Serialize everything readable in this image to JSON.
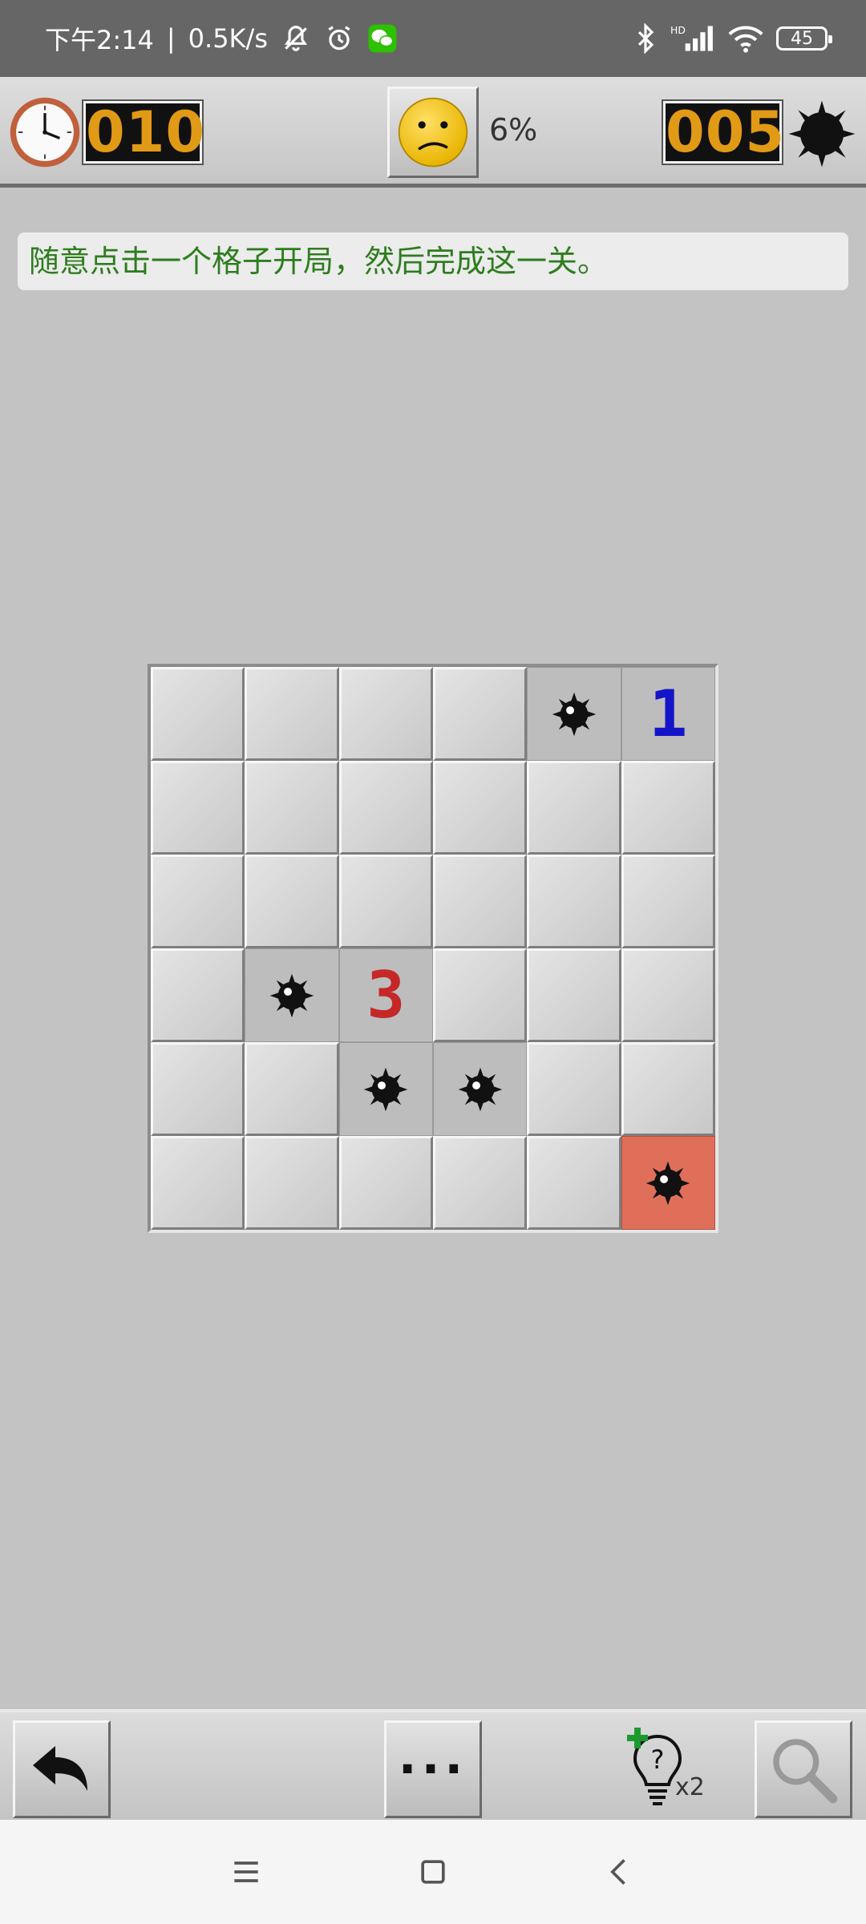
{
  "status_bar": {
    "time": "下午2:14",
    "network_speed": "0.5K/s",
    "battery_level": "45",
    "icons": [
      "mute-icon",
      "alarm-icon",
      "wechat-icon",
      "bluetooth-icon",
      "hd-signal-icon",
      "wifi-icon",
      "battery-icon"
    ]
  },
  "game_bar": {
    "timer": "010",
    "progress": "6%",
    "mines_remaining": "005",
    "face_state": "sad"
  },
  "hint_message": "随意点击一个格子开局，然后完成这一关。",
  "board": {
    "rows": 6,
    "cols": 6,
    "cells": [
      [
        "closed",
        "closed",
        "closed",
        "closed",
        "mine",
        "1"
      ],
      [
        "closed",
        "closed",
        "closed",
        "closed",
        "closed",
        "closed"
      ],
      [
        "closed",
        "closed",
        "closed",
        "closed",
        "closed",
        "closed"
      ],
      [
        "closed",
        "mine",
        "3",
        "closed",
        "closed",
        "closed"
      ],
      [
        "closed",
        "closed",
        "mine",
        "mine",
        "closed",
        "closed"
      ],
      [
        "closed",
        "closed",
        "closed",
        "closed",
        "closed",
        "exploded"
      ]
    ],
    "number_colors": {
      "1": "#1414c8",
      "3": "#c62828"
    },
    "exploded_color": "#e06f5a"
  },
  "toolbar": {
    "undo_icon": "undo-arrow-icon",
    "more_label": "···",
    "hint_count": "x2",
    "search_icon": "magnifier-icon"
  },
  "nav_bar": {
    "icons": [
      "menu-icon",
      "home-icon",
      "back-icon"
    ]
  }
}
